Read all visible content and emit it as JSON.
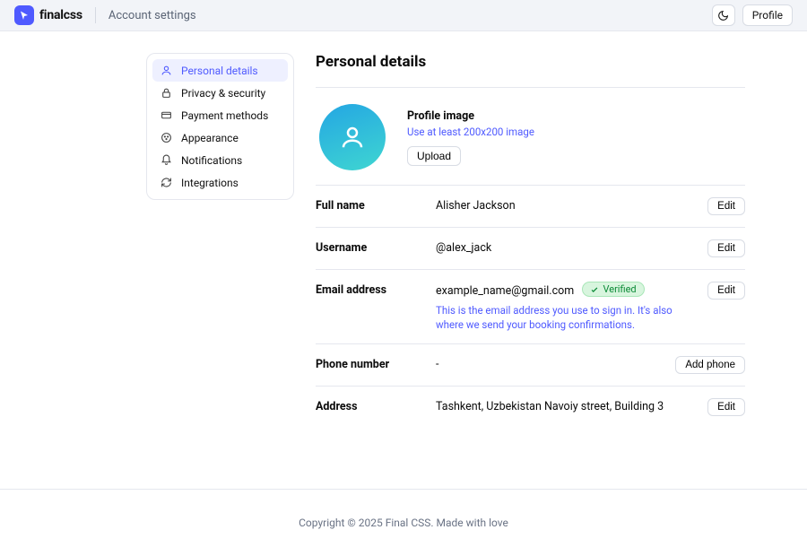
{
  "header": {
    "brand": "finalcss",
    "breadcrumb": "Account settings",
    "profile_label": "Profile"
  },
  "sidebar": {
    "items": [
      {
        "label": "Personal details"
      },
      {
        "label": "Privacy & security"
      },
      {
        "label": "Payment methods"
      },
      {
        "label": "Appearance"
      },
      {
        "label": "Notifications"
      },
      {
        "label": "Integrations"
      }
    ]
  },
  "page": {
    "title": "Personal details",
    "profile_image": {
      "title": "Profile image",
      "hint": "Use at least 200x200 image",
      "upload_label": "Upload"
    },
    "rows": {
      "full_name": {
        "label": "Full name",
        "value": "Alisher Jackson",
        "action": "Edit"
      },
      "username": {
        "label": "Username",
        "value": "@alex_jack",
        "action": "Edit"
      },
      "email": {
        "label": "Email address",
        "value": "example_name@gmail.com",
        "badge": "Verified",
        "sub": "This is the email address you use to sign in. It's also where we send your booking confirmations.",
        "action": "Edit"
      },
      "phone": {
        "label": "Phone number",
        "value": "-",
        "action": "Add phone"
      },
      "address": {
        "label": "Address",
        "value": "Tashkent, Uzbekistan Navoiy street, Building 3",
        "action": "Edit"
      }
    }
  },
  "footer": {
    "text": "Copyright © 2025 Final CSS. Made with love"
  }
}
